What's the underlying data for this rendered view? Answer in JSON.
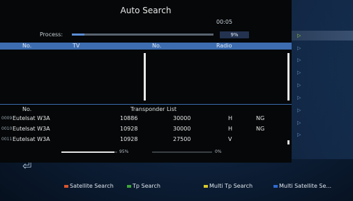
{
  "dialog": {
    "title": "Auto Search",
    "time": "00:05",
    "process_label": "Process:",
    "process_percent_label": "9%",
    "process_fraction": 0.09,
    "columns": {
      "no_tv": "No.",
      "tv": "TV",
      "no_radio": "No.",
      "radio": "Radio"
    },
    "tv_list": [],
    "radio_list": [],
    "transponder": {
      "no_label": "No.",
      "title": "Transponder List",
      "rows": [
        {
          "num": "0009",
          "satellite": "Eutelsat W3A",
          "freq": "10886",
          "symbol": "30000",
          "pol": "H",
          "extra": "NG"
        },
        {
          "num": "0010",
          "satellite": "Eutelsat W3A",
          "freq": "10928",
          "symbol": "30000",
          "pol": "H",
          "extra": "NG"
        },
        {
          "num": "0011",
          "satellite": "Eutelsat W3A",
          "freq": "10928",
          "symbol": "27500",
          "pol": "V",
          "extra": ""
        }
      ]
    },
    "signal": {
      "strength_label": "95%",
      "strength_fraction": 0.95,
      "quality_label": "0%",
      "quality_fraction": 0.0
    }
  },
  "footer": {
    "items": [
      {
        "label": "Satellite Search",
        "color": "#d9552e"
      },
      {
        "label": "Tp Search",
        "color": "#3fa63a"
      },
      {
        "label": "Multi Tp Search",
        "color": "#d8c72a"
      },
      {
        "label": "Multi Satellite Se...",
        "color": "#2f6ad0"
      }
    ]
  },
  "colors": {
    "accent": "#3d6db0",
    "dialog_bg": "#050708"
  }
}
